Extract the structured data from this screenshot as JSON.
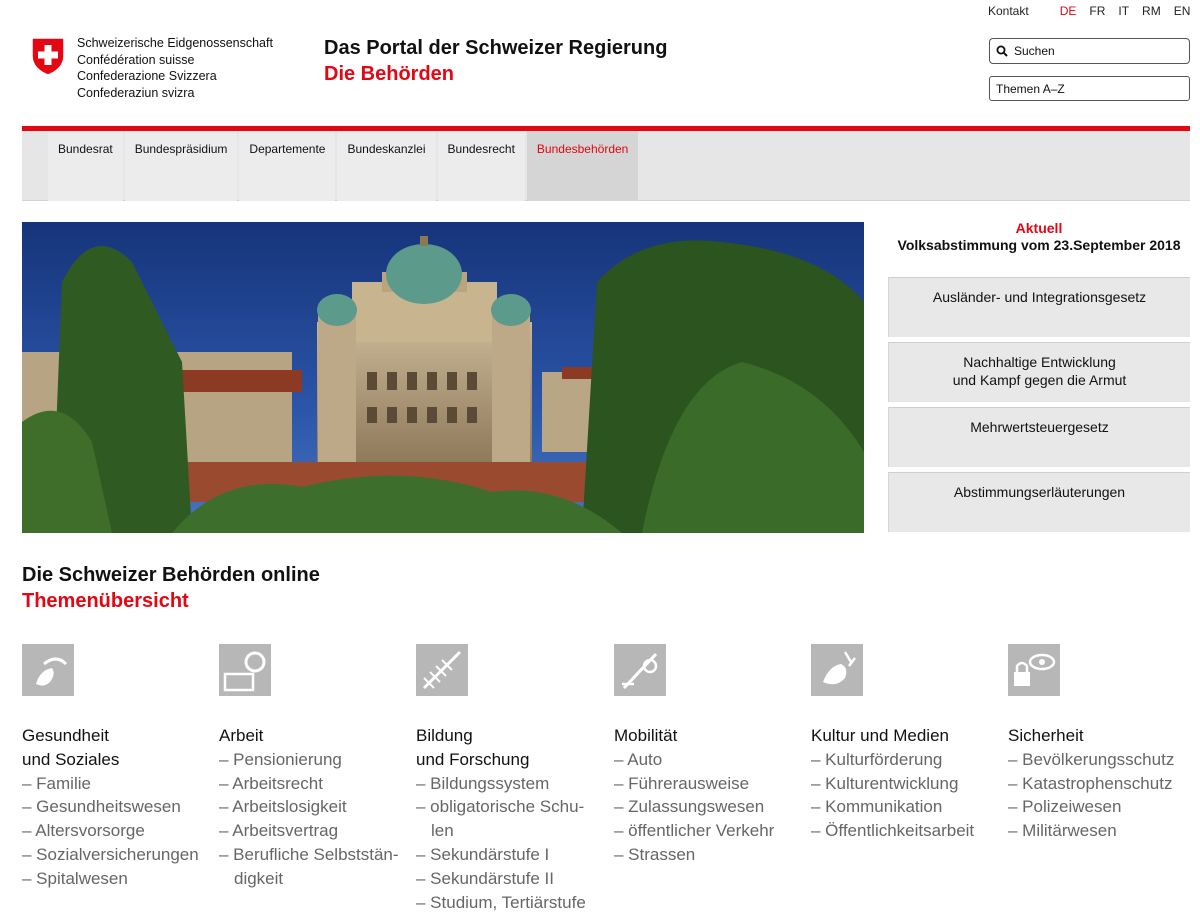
{
  "topbar": {
    "kontakt": "Kontakt",
    "languages": [
      {
        "label": "DE",
        "active": true
      },
      {
        "label": "FR",
        "active": false
      },
      {
        "label": "IT",
        "active": false
      },
      {
        "label": "RM",
        "active": false
      },
      {
        "label": "EN",
        "active": false
      }
    ]
  },
  "header": {
    "confederation_names": [
      "Schweizerische Eidgenossenschaft",
      "Confédération suisse",
      "Confederazione Svizzera",
      "Confederaziun svizra"
    ],
    "portal_title": "Das Portal der Schweizer Regierung",
    "portal_subtitle": "Die Behörden",
    "search_label": "Suchen",
    "themen_label": "Themen A–Z",
    "icons": {
      "logo": "swiss-shield-icon",
      "search": "search-icon"
    }
  },
  "nav": {
    "items": [
      {
        "label": "Bundesrat",
        "active": false
      },
      {
        "label": "Bundespräsidium",
        "active": false
      },
      {
        "label": "Departemente",
        "active": false
      },
      {
        "label": "Bundeskanzlei",
        "active": false
      },
      {
        "label": "Bundesrecht",
        "active": false
      },
      {
        "label": "Bundesbehörden",
        "active": true
      }
    ]
  },
  "aktuell": {
    "label": "Aktuell",
    "title": "Volksabstimmung vom 23.September 2018",
    "cards": [
      [
        "Ausländer- und Integrationsgesetz"
      ],
      [
        "Nachhaltige Entwicklung",
        "und Kampf gegen die Armut"
      ],
      [
        "Mehrwertsteuergesetz"
      ],
      [
        "Abstimmungserläuterungen"
      ]
    ]
  },
  "section": {
    "title": "Die Schweizer Behörden online",
    "subtitle": "Themenübersicht"
  },
  "categories": [
    {
      "icon": "health-icon",
      "title": [
        "Gesundheit",
        "und Soziales"
      ],
      "items": [
        "– Familie",
        "– Gesundheitswesen",
        "– Altersvorsorge",
        "– Sozialversicherungen",
        "– Spitalwesen"
      ]
    },
    {
      "icon": "work-icon",
      "title": [
        "Arbeit"
      ],
      "items": [
        "– Pensionierung",
        "– Arbeitsrecht",
        "– Arbeitslosigkeit",
        "– Arbeitsvertrag",
        "– Berufliche Selbststän-digkeit"
      ]
    },
    {
      "icon": "education-icon",
      "title": [
        "Bildung",
        "und Forschung"
      ],
      "items": [
        "– Bildungssystem",
        "– obligatorische Schu-len",
        "– Sekundärstufe I",
        "– Sekundärstufe II",
        "– Studium, Tertiärstufe"
      ]
    },
    {
      "icon": "mobility-icon",
      "title": [
        "Mobilität"
      ],
      "items": [
        "– Auto",
        "– Führerausweise",
        "– Zulassungswesen",
        "– öffentlicher Verkehr",
        "– Strassen"
      ]
    },
    {
      "icon": "culture-icon",
      "title": [
        "Kultur und Medien"
      ],
      "items": [
        "– Kulturförderung",
        "– Kulturentwicklung",
        "– Kommunikation",
        "– Öffentlichkeitsarbeit"
      ]
    },
    {
      "icon": "security-icon",
      "title": [
        "Sicherheit"
      ],
      "items": [
        "– Bevölkerungsschutz",
        "– Katastrophenschutz",
        "– Polizeiwesen",
        "– Militärwesen"
      ]
    }
  ],
  "colors": {
    "accent": "#e30613",
    "nav_bg": "#e6e6e6",
    "card_bg": "#e8e8e8",
    "icon_gray": "#b7b7b7"
  }
}
